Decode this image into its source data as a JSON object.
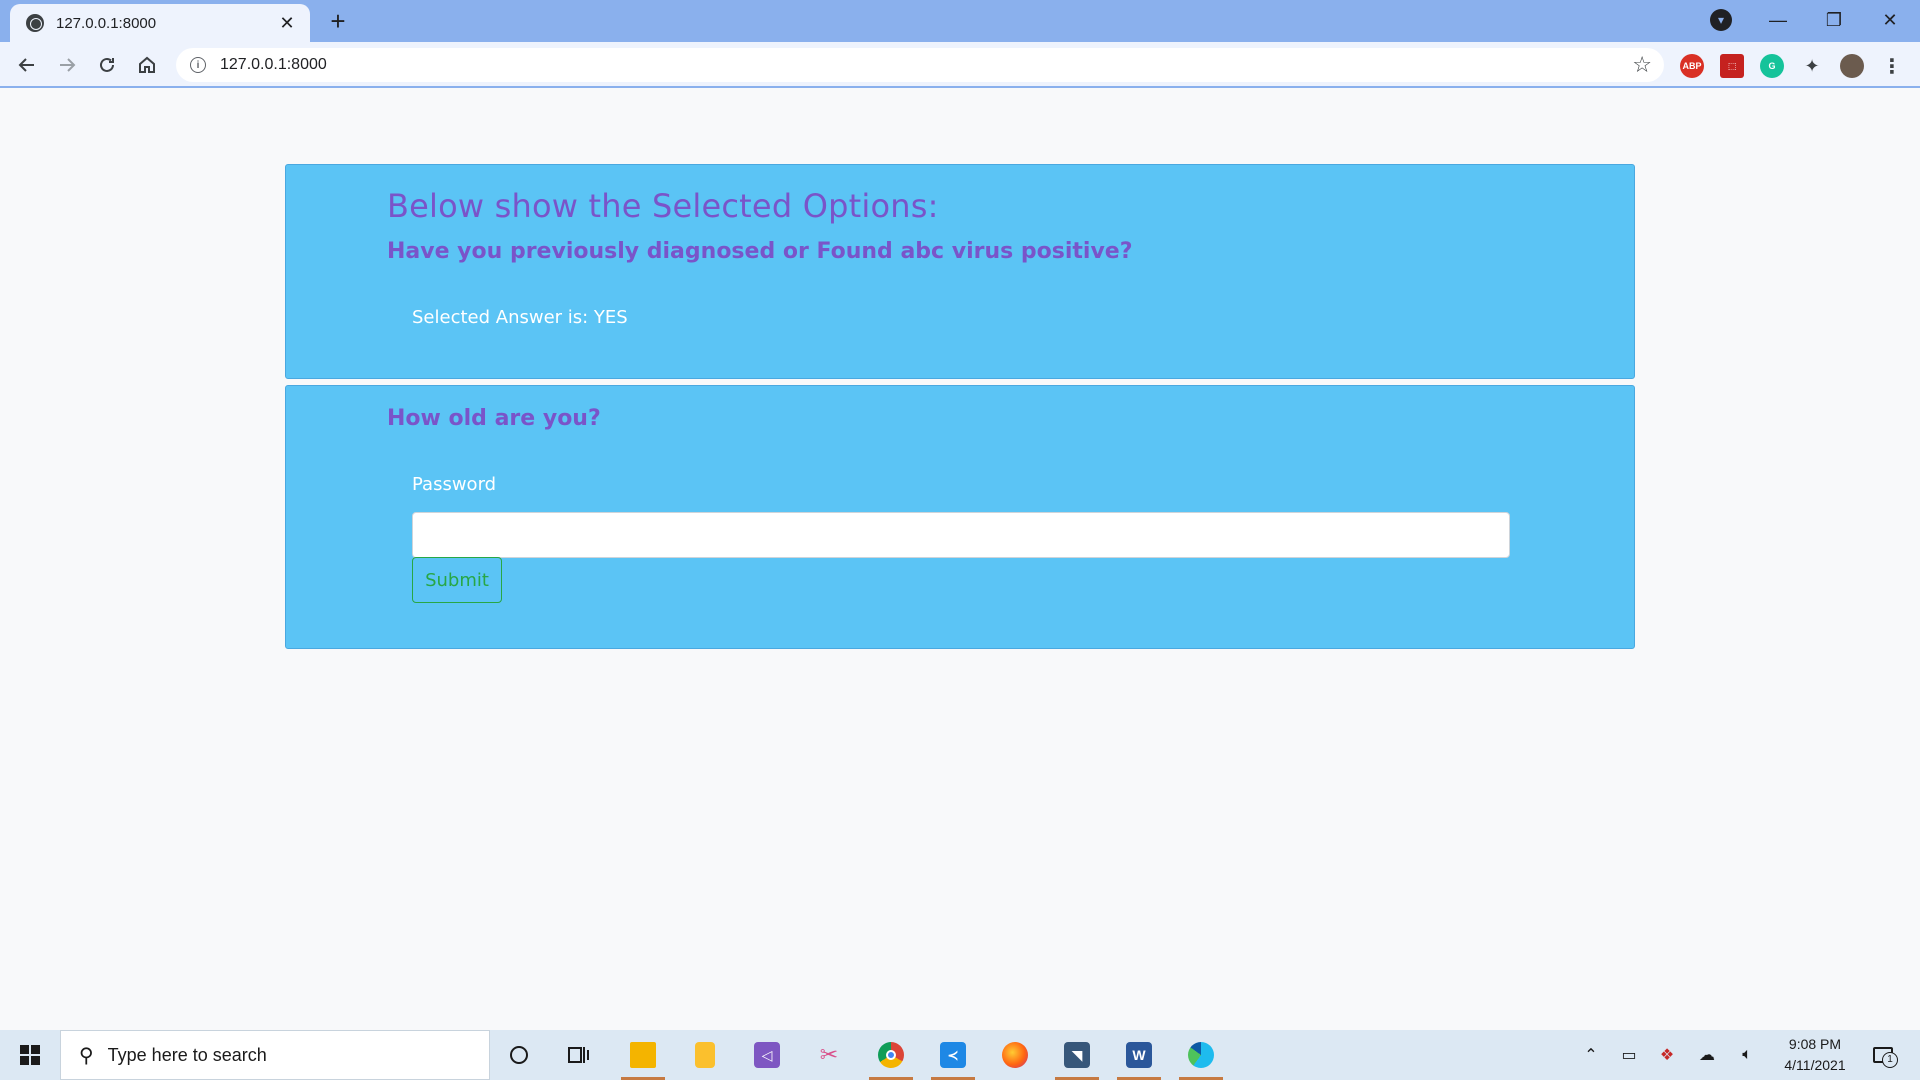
{
  "browser": {
    "tab_title": "127.0.0.1:8000",
    "tab_close": "✕",
    "new_tab": "+",
    "url": "127.0.0.1:8000",
    "window_controls": {
      "minimize": "—",
      "restore": "❐",
      "close": "✕"
    }
  },
  "page": {
    "card1": {
      "title": "Below show the Selected Options:",
      "question": "Have you previously diagnosed or Found abc virus positive?",
      "answer": "Selected Answer is: YES"
    },
    "card2": {
      "question": "How old are you?",
      "password_label": "Password",
      "password_value": "",
      "submit_label": "Submit"
    }
  },
  "taskbar": {
    "search_placeholder": "Type here to search",
    "time": "9:08 PM",
    "date": "4/11/2021",
    "notification_count": "1"
  },
  "colors": {
    "card_bg": "#5bc4f5",
    "heading": "#7a54c9",
    "submit_outline": "#28a745",
    "tabbar": "#8ab0ed"
  }
}
